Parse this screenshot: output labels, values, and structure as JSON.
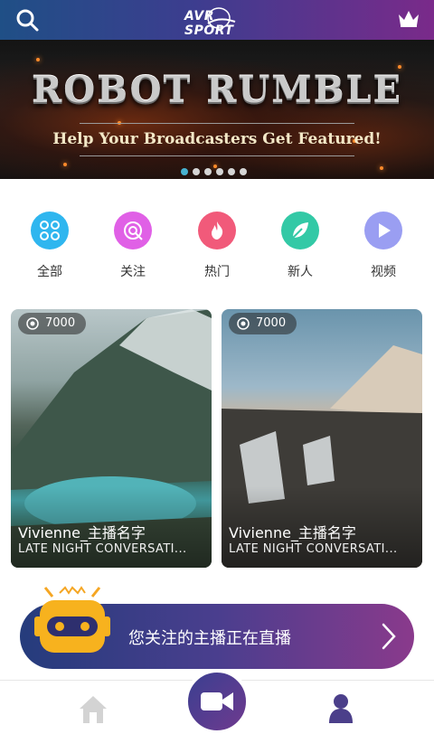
{
  "topbar": {
    "logo_text": "AVR SPORT",
    "search_icon": "search-icon",
    "crown_icon": "crown-icon",
    "gradient": [
      "#1f4f86",
      "#7a2a8a"
    ]
  },
  "banner": {
    "title": "ROBOT RUMBLE",
    "tagline": "Help Your Broadcasters Get Featured!",
    "active_dot_index": 0,
    "dot_count": 6
  },
  "categories": [
    {
      "label": "全部",
      "icon": "grid-icon",
      "color": "#2fb6ef"
    },
    {
      "label": "关注",
      "icon": "target-icon",
      "color": "#e060e6"
    },
    {
      "label": "热门",
      "icon": "flame-icon",
      "color": "#f15a7a"
    },
    {
      "label": "新人",
      "icon": "leaf-icon",
      "color": "#33c9a6"
    },
    {
      "label": "视频",
      "icon": "play-icon",
      "color": "#9a9ef2"
    }
  ],
  "cards": [
    {
      "views": "7000",
      "name": "Vivienne_主播名字",
      "desc": "LATE NIGHT CONVERSATI..."
    },
    {
      "views": "7000",
      "name": "Vivienne_主播名字",
      "desc": "LATE NIGHT CONVERSATI..."
    }
  ],
  "live_banner": {
    "text": "您关注的主播正在直播"
  },
  "tabbar": {
    "home_icon": "home-icon",
    "center_icon": "video-camera-icon",
    "me_icon": "user-icon"
  }
}
